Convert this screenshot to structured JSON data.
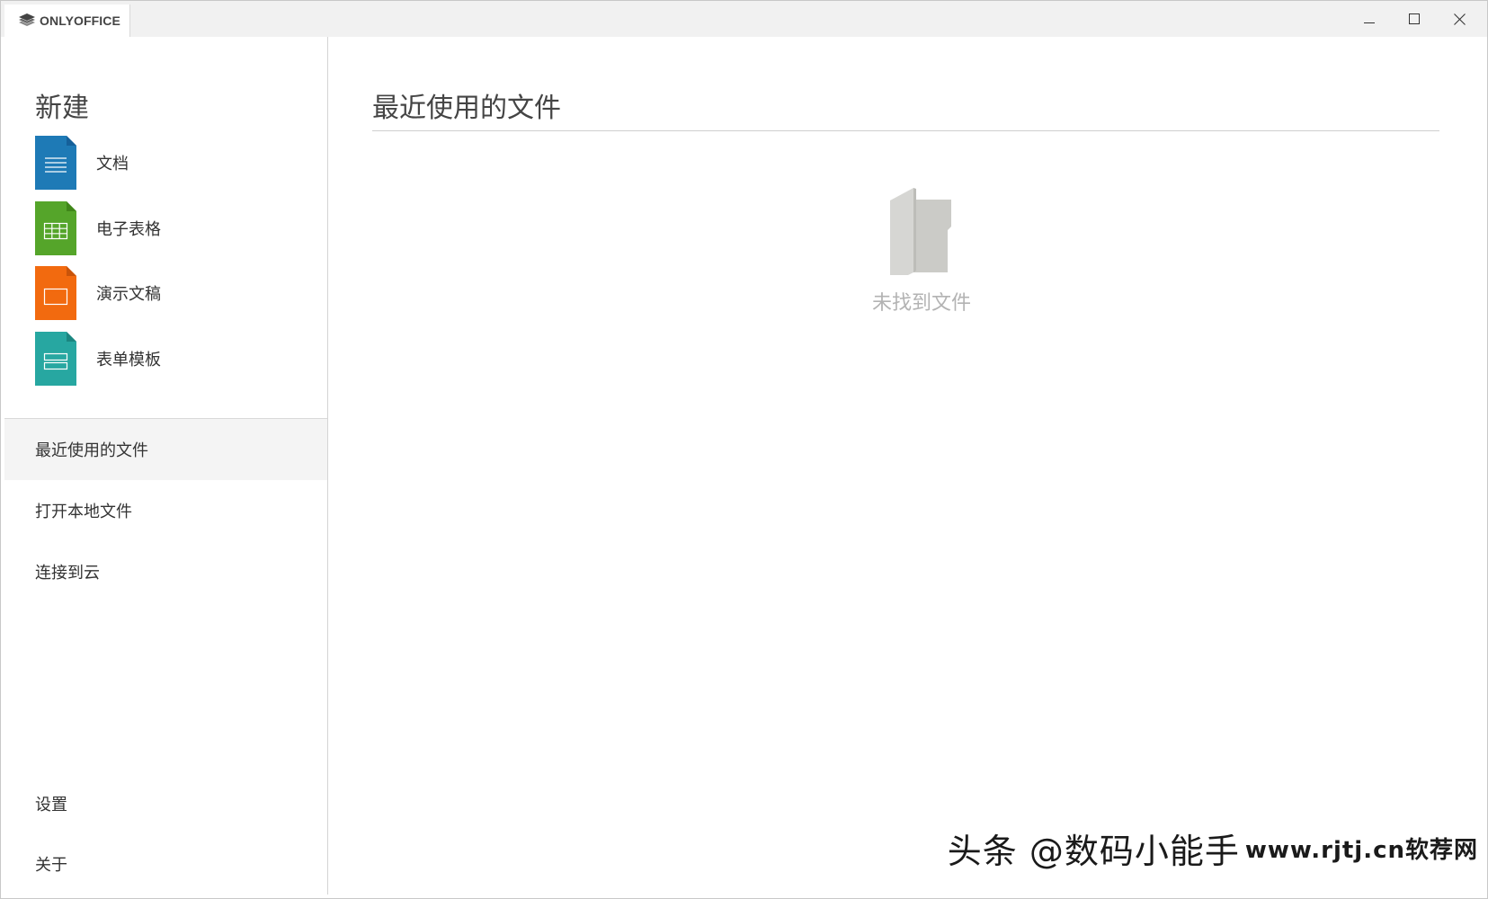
{
  "window": {
    "app_name": "ONLYOFFICE",
    "controls": {
      "minimize": "minimize-icon",
      "maximize": "maximize-icon",
      "close": "close-icon"
    }
  },
  "sidebar": {
    "new_title": "新建",
    "new_items": [
      {
        "label": "文档",
        "icon": "document-icon",
        "color": "#1e7ab6"
      },
      {
        "label": "电子表格",
        "icon": "spreadsheet-icon",
        "color": "#55a52a"
      },
      {
        "label": "演示文稿",
        "icon": "presentation-icon",
        "color": "#f26a0f"
      },
      {
        "label": "表单模板",
        "icon": "form-template-icon",
        "color": "#27a7a1"
      }
    ],
    "nav": [
      {
        "label": "最近使用的文件",
        "active": true
      },
      {
        "label": "打开本地文件",
        "active": false
      },
      {
        "label": "连接到云",
        "active": false
      }
    ],
    "bottom": [
      {
        "label": "设置"
      },
      {
        "label": "关于"
      }
    ]
  },
  "main": {
    "title": "最近使用的文件",
    "empty_icon": "empty-folder-icon",
    "empty_text": "未找到文件"
  },
  "watermark": {
    "left": "头条 @数码小能手",
    "right": "www.rjtj.cn软荐网"
  }
}
